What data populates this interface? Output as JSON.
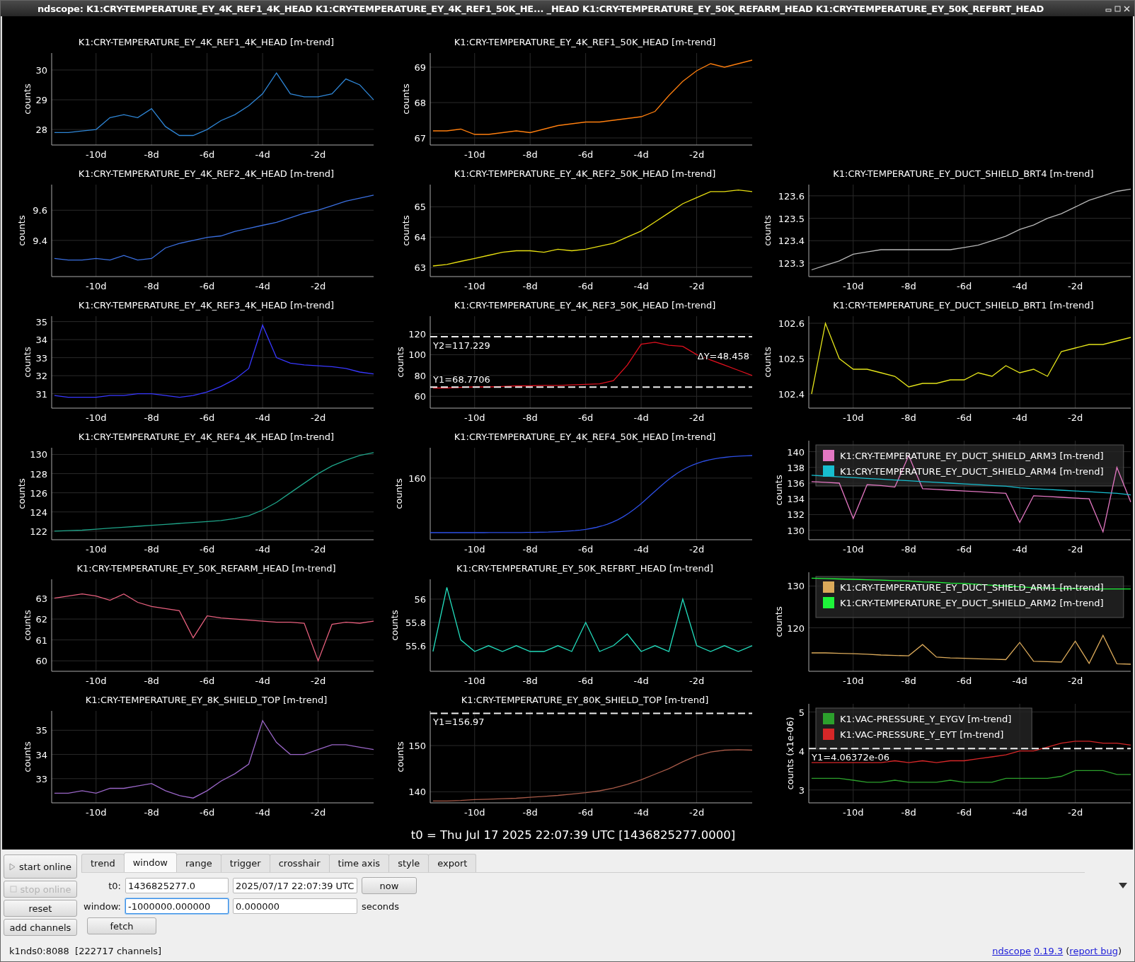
{
  "window": {
    "title": "ndscope: K1:CRY-TEMPERATURE_EY_4K_REF1_4K_HEAD K1:CRY-TEMPERATURE_EY_4K_REF1_50K_HE...  _HEAD K1:CRY-TEMPERATURE_EY_50K_REFARM_HEAD K1:CRY-TEMPERATURE_EY_50K_REFBRT_HEAD"
  },
  "plots": [
    {
      "kind": "chart",
      "chart_data": {
        "type": "line",
        "title": "K1:CRY-TEMPERATURE_EY_4K_REF1_4K_HEAD [m-trend]",
        "ylabel": "counts",
        "grid": true,
        "x": [
          -11.5,
          -11,
          -10.5,
          -10,
          -9.5,
          -9,
          -8.5,
          -8,
          -7.5,
          -7,
          -6.5,
          -6,
          -5.5,
          -5,
          -4.5,
          -4,
          -3.5,
          -3,
          -2.5,
          -2,
          -1.5,
          -1,
          -0.5,
          0
        ],
        "xlim": [
          -11.6,
          0
        ],
        "ylim": [
          27.48,
          30.57
        ],
        "xticks": [
          {
            "value": -10,
            "label": "-10d"
          },
          {
            "value": -8,
            "label": "-8d"
          },
          {
            "value": -6,
            "label": "-6d"
          },
          {
            "value": -4,
            "label": "-4d"
          },
          {
            "value": -2,
            "label": "-2d"
          }
        ],
        "yticks": [
          28,
          29,
          30
        ],
        "series": [
          {
            "color": "#2f86d6",
            "values": [
              27.9,
              27.9,
              27.95,
              28.0,
              28.4,
              28.5,
              28.4,
              28.7,
              28.1,
              27.8,
              27.8,
              28.0,
              28.3,
              28.5,
              28.8,
              29.2,
              29.9,
              29.2,
              29.1,
              29.1,
              29.2,
              29.7,
              29.5,
              29.0
            ]
          }
        ]
      }
    },
    {
      "kind": "chart",
      "chart_data": {
        "type": "line",
        "title": "K1:CRY-TEMPERATURE_EY_4K_REF1_50K_HEAD [m-trend]",
        "ylabel": "counts",
        "grid": true,
        "x": [
          -11.5,
          -11,
          -10.5,
          -10,
          -9.5,
          -9,
          -8.5,
          -8,
          -7.5,
          -7,
          -6.5,
          -6,
          -5.5,
          -5,
          -4.5,
          -4,
          -3.5,
          -3,
          -2.5,
          -2,
          -1.5,
          -1,
          -0.5,
          0
        ],
        "xlim": [
          -11.6,
          0
        ],
        "ylim": [
          66.8,
          69.4
        ],
        "xticks": [
          {
            "value": -10,
            "label": "-10d"
          },
          {
            "value": -8,
            "label": "-8d"
          },
          {
            "value": -6,
            "label": "-6d"
          },
          {
            "value": -4,
            "label": "-4d"
          },
          {
            "value": -2,
            "label": "-2d"
          }
        ],
        "yticks": [
          67,
          68,
          69
        ],
        "series": [
          {
            "color": "#ff7f0e",
            "values": [
              67.2,
              67.2,
              67.25,
              67.1,
              67.1,
              67.15,
              67.2,
              67.15,
              67.25,
              67.35,
              67.4,
              67.45,
              67.45,
              67.5,
              67.55,
              67.6,
              67.75,
              68.2,
              68.6,
              68.9,
              69.1,
              69.0,
              69.1,
              69.2
            ]
          }
        ]
      }
    },
    {
      "kind": "empty"
    },
    {
      "kind": "chart",
      "chart_data": {
        "type": "line",
        "title": "K1:CRY-TEMPERATURE_EY_4K_REF2_4K_HEAD [m-trend]",
        "ylabel": "counts",
        "grid": true,
        "x": [
          -11.5,
          -11,
          -10.5,
          -10,
          -9.5,
          -9,
          -8.5,
          -8,
          -7.5,
          -7,
          -6.5,
          -6,
          -5.5,
          -5,
          -4.5,
          -4,
          -3.5,
          -3,
          -2.5,
          -2,
          -1.5,
          -1,
          -0.5,
          0
        ],
        "xlim": [
          -11.6,
          0
        ],
        "ylim": [
          9.16,
          9.77
        ],
        "xticks": [
          {
            "value": -10,
            "label": "-10d"
          },
          {
            "value": -8,
            "label": "-8d"
          },
          {
            "value": -6,
            "label": "-6d"
          },
          {
            "value": -4,
            "label": "-4d"
          },
          {
            "value": -2,
            "label": "-2d"
          }
        ],
        "yticks": [
          9.4,
          9.6
        ],
        "series": [
          {
            "color": "#3a6fe0",
            "values": [
              9.28,
              9.27,
              9.27,
              9.28,
              9.27,
              9.3,
              9.27,
              9.28,
              9.35,
              9.38,
              9.4,
              9.42,
              9.43,
              9.46,
              9.48,
              9.5,
              9.52,
              9.55,
              9.58,
              9.6,
              9.63,
              9.66,
              9.68,
              9.7
            ]
          }
        ]
      }
    },
    {
      "kind": "chart",
      "chart_data": {
        "type": "line",
        "title": "K1:CRY-TEMPERATURE_EY_4K_REF2_50K_HEAD [m-trend]",
        "ylabel": "counts",
        "grid": true,
        "x": [
          -11.5,
          -11,
          -10.5,
          -10,
          -9.5,
          -9,
          -8.5,
          -8,
          -7.5,
          -7,
          -6.5,
          -6,
          -5.5,
          -5,
          -4.5,
          -4,
          -3.5,
          -3,
          -2.5,
          -2,
          -1.5,
          -1,
          -0.5,
          0
        ],
        "xlim": [
          -11.6,
          0
        ],
        "ylim": [
          62.7,
          65.73
        ],
        "xticks": [
          {
            "value": -10,
            "label": "-10d"
          },
          {
            "value": -8,
            "label": "-8d"
          },
          {
            "value": -6,
            "label": "-6d"
          },
          {
            "value": -4,
            "label": "-4d"
          },
          {
            "value": -2,
            "label": "-2d"
          }
        ],
        "yticks": [
          63,
          64,
          65
        ],
        "series": [
          {
            "color": "#e8e010",
            "values": [
              63.05,
              63.1,
              63.2,
              63.3,
              63.4,
              63.5,
              63.55,
              63.55,
              63.5,
              63.6,
              63.55,
              63.6,
              63.7,
              63.8,
              64.0,
              64.2,
              64.5,
              64.8,
              65.1,
              65.3,
              65.5,
              65.5,
              65.55,
              65.5
            ]
          }
        ]
      }
    },
    {
      "kind": "chart",
      "chart_data": {
        "type": "line",
        "title": "K1:CRY-TEMPERATURE_EY_DUCT_SHIELD_BRT4 [m-trend]",
        "ylabel": "counts",
        "grid": true,
        "x": [
          -11.5,
          -11,
          -10.5,
          -10,
          -9.5,
          -9,
          -8.5,
          -8,
          -7.5,
          -7,
          -6.5,
          -6,
          -5.5,
          -5,
          -4.5,
          -4,
          -3.5,
          -3,
          -2.5,
          -2,
          -1.5,
          -1,
          -0.5,
          0
        ],
        "xlim": [
          -11.6,
          0
        ],
        "ylim": [
          123.24,
          123.65
        ],
        "xticks": [
          {
            "value": -10,
            "label": "-10d"
          },
          {
            "value": -8,
            "label": "-8d"
          },
          {
            "value": -6,
            "label": "-6d"
          },
          {
            "value": -4,
            "label": "-4d"
          },
          {
            "value": -2,
            "label": "-2d"
          }
        ],
        "yticks": [
          123.3,
          123.4,
          123.5,
          123.6
        ],
        "series": [
          {
            "color": "#b8b8b8",
            "values": [
              123.27,
              123.29,
              123.31,
              123.34,
              123.35,
              123.36,
              123.36,
              123.36,
              123.36,
              123.36,
              123.36,
              123.37,
              123.38,
              123.4,
              123.42,
              123.45,
              123.47,
              123.5,
              123.52,
              123.55,
              123.58,
              123.6,
              123.62,
              123.63
            ]
          }
        ]
      }
    },
    {
      "kind": "chart",
      "chart_data": {
        "type": "line",
        "title": "K1:CRY-TEMPERATURE_EY_4K_REF3_4K_HEAD [m-trend]",
        "ylabel": "counts",
        "grid": true,
        "x": [
          -11.5,
          -11,
          -10.5,
          -10,
          -9.5,
          -9,
          -8.5,
          -8,
          -7.5,
          -7,
          -6.5,
          -6,
          -5.5,
          -5,
          -4.5,
          -4,
          -3.5,
          -3,
          -2.5,
          -2,
          -1.5,
          -1,
          -0.5,
          0
        ],
        "xlim": [
          -11.6,
          0
        ],
        "ylim": [
          30.2,
          35.3
        ],
        "xticks": [
          {
            "value": -10,
            "label": "-10d"
          },
          {
            "value": -8,
            "label": "-8d"
          },
          {
            "value": -6,
            "label": "-6d"
          },
          {
            "value": -4,
            "label": "-4d"
          },
          {
            "value": -2,
            "label": "-2d"
          }
        ],
        "yticks": [
          31,
          32,
          33,
          34,
          35
        ],
        "series": [
          {
            "color": "#3838ff",
            "values": [
              30.9,
              30.8,
              30.8,
              30.8,
              30.9,
              30.9,
              31.0,
              31.0,
              30.9,
              30.8,
              30.9,
              31.1,
              31.4,
              31.8,
              32.4,
              34.8,
              33.0,
              32.7,
              32.6,
              32.55,
              32.5,
              32.4,
              32.2,
              32.1
            ]
          }
        ]
      }
    },
    {
      "kind": "chart",
      "chart_data": {
        "type": "line",
        "title": "K1:CRY-TEMPERATURE_EY_4K_REF3_50K_HEAD [m-trend]",
        "ylabel": "counts",
        "grid": true,
        "x": [
          -11.5,
          -11,
          -10.5,
          -10,
          -9.5,
          -9,
          -8.5,
          -8,
          -7.5,
          -7,
          -6.5,
          -6,
          -5.5,
          -5,
          -4.5,
          -4,
          -3.5,
          -3,
          -2.5,
          -2,
          -1.5,
          -1,
          -0.5,
          0
        ],
        "xlim": [
          -11.6,
          0
        ],
        "ylim": [
          48.6,
          137
        ],
        "xticks": [
          {
            "value": -10,
            "label": "-10d"
          },
          {
            "value": -8,
            "label": "-8d"
          },
          {
            "value": -6,
            "label": "-6d"
          },
          {
            "value": -4,
            "label": "-4d"
          },
          {
            "value": -2,
            "label": "-2d"
          }
        ],
        "yticks": [
          60,
          80,
          100,
          120
        ],
        "series": [
          {
            "color": "#e0101e",
            "values": [
              68,
              68,
              68.5,
              69,
              69,
              69.5,
              70,
              70,
              70.5,
              70.5,
              71,
              71.5,
              72,
              75,
              90,
              110,
              112,
              109,
              108,
              100,
              95,
              90,
              85,
              80
            ]
          }
        ],
        "ref_lines": [
          {
            "axis": "y",
            "value": 117.229,
            "label": "Y2=117.229"
          },
          {
            "axis": "y",
            "value": 68.7706,
            "label": "Y1=68.7706"
          }
        ],
        "annotations": [
          {
            "text": "ΔY=48.458"
          }
        ]
      }
    },
    {
      "kind": "chart",
      "chart_data": {
        "type": "line",
        "title": "K1:CRY-TEMPERATURE_EY_DUCT_SHIELD_BRT1 [m-trend]",
        "ylabel": "counts",
        "grid": true,
        "x": [
          -11.5,
          -11,
          -10.5,
          -10,
          -9.5,
          -9,
          -8.5,
          -8,
          -7.5,
          -7,
          -6.5,
          -6,
          -5.5,
          -5,
          -4.5,
          -4,
          -3.5,
          -3,
          -2.5,
          -2,
          -1.5,
          -1,
          -0.5,
          0
        ],
        "xlim": [
          -11.6,
          0
        ],
        "ylim": [
          102.36,
          102.62
        ],
        "xticks": [
          {
            "value": -10,
            "label": "-10d"
          },
          {
            "value": -8,
            "label": "-8d"
          },
          {
            "value": -6,
            "label": "-6d"
          },
          {
            "value": -4,
            "label": "-4d"
          },
          {
            "value": -2,
            "label": "-2d"
          }
        ],
        "yticks": [
          102.4,
          102.5,
          102.6
        ],
        "series": [
          {
            "color": "#e4e41a",
            "values": [
              102.4,
              102.6,
              102.5,
              102.47,
              102.47,
              102.46,
              102.45,
              102.42,
              102.43,
              102.43,
              102.44,
              102.44,
              102.46,
              102.45,
              102.48,
              102.46,
              102.47,
              102.45,
              102.52,
              102.53,
              102.54,
              102.54,
              102.55,
              102.56
            ]
          }
        ]
      }
    },
    {
      "kind": "chart",
      "chart_data": {
        "type": "line",
        "title": "K1:CRY-TEMPERATURE_EY_4K_REF4_4K_HEAD [m-trend]",
        "ylabel": "counts",
        "grid": true,
        "x": [
          -11.5,
          -11,
          -10.5,
          -10,
          -9.5,
          -9,
          -8.5,
          -8,
          -7.5,
          -7,
          -6.5,
          -6,
          -5.5,
          -5,
          -4.5,
          -4,
          -3.5,
          -3,
          -2.5,
          -2,
          -1.5,
          -1,
          -0.5,
          0
        ],
        "xlim": [
          -11.6,
          0
        ],
        "ylim": [
          121.1,
          130.7
        ],
        "xticks": [
          {
            "value": -10,
            "label": "-10d"
          },
          {
            "value": -8,
            "label": "-8d"
          },
          {
            "value": -6,
            "label": "-6d"
          },
          {
            "value": -4,
            "label": "-4d"
          },
          {
            "value": -2,
            "label": "-2d"
          }
        ],
        "yticks": [
          122,
          124,
          126,
          128,
          130
        ],
        "series": [
          {
            "color": "#1fa58a",
            "values": [
              122,
              122.05,
              122.1,
              122.2,
              122.3,
              122.4,
              122.5,
              122.6,
              122.7,
              122.8,
              122.9,
              123,
              123.1,
              123.3,
              123.6,
              124.2,
              125,
              126,
              127,
              128,
              128.8,
              129.4,
              129.9,
              130.2
            ]
          }
        ]
      }
    },
    {
      "kind": "trace",
      "title": "K1:CRY-TEMPERATURE_EY_4K_REF4_50K_HEAD [m-trend]",
      "ylabel": "counts",
      "ytick": "160",
      "xticks": [
        "-10d",
        "-8d",
        "-6d",
        "-4d",
        "-2d"
      ],
      "color": "#2d4fe6"
    },
    {
      "kind": "chart",
      "chart_data": {
        "type": "line",
        "ylabel": "counts",
        "grid": true,
        "x": [
          -11.5,
          -11,
          -10.5,
          -10,
          -9.5,
          -9,
          -8.5,
          -8,
          -7.5,
          -7,
          -6.5,
          -6,
          -5.5,
          -5,
          -4.5,
          -4,
          -3.5,
          -3,
          -2.5,
          -2,
          -1.5,
          -1,
          -0.5,
          0
        ],
        "xlim": [
          -11.6,
          0
        ],
        "ylim": [
          128.8,
          141.4
        ],
        "xticks": [
          {
            "value": -10,
            "label": "-10d"
          },
          {
            "value": -8,
            "label": "-8d"
          },
          {
            "value": -6,
            "label": "-6d"
          },
          {
            "value": -4,
            "label": "-4d"
          },
          {
            "value": -2,
            "label": "-2d"
          }
        ],
        "yticks": [
          130,
          132,
          134,
          136,
          138,
          140
        ],
        "series": [
          {
            "name": "K1:CRY-TEMPERATURE_EY_DUCT_SHIELD_ARM3 [m-trend]",
            "color": "#e377c2",
            "values": [
              136.2,
              136.1,
              136.0,
              131.5,
              135.8,
              135.7,
              135.5,
              139.5,
              135.3,
              135.2,
              135.1,
              135.0,
              134.9,
              134.8,
              134.7,
              131.0,
              134.4,
              134.3,
              134.2,
              134.1,
              134.0,
              129.8,
              138.0,
              133.6
            ]
          },
          {
            "name": "K1:CRY-TEMPERATURE_EY_DUCT_SHIELD_ARM4 [m-trend]",
            "color": "#17becf",
            "values": [
              137.0,
              136.9,
              136.8,
              136.7,
              136.6,
              136.5,
              136.4,
              136.3,
              136.2,
              136.1,
              136.0,
              135.9,
              135.8,
              135.7,
              135.6,
              135.4,
              135.3,
              135.2,
              135.1,
              135.0,
              134.9,
              134.8,
              134.7,
              134.5
            ]
          }
        ]
      }
    },
    {
      "kind": "chart",
      "chart_data": {
        "type": "line",
        "title": "K1:CRY-TEMPERATURE_EY_50K_REFARM_HEAD [m-trend]",
        "ylabel": "counts",
        "grid": true,
        "x": [
          -11.5,
          -11,
          -10.5,
          -10,
          -9.5,
          -9,
          -8.5,
          -8,
          -7.5,
          -7,
          -6.5,
          -6,
          -5.5,
          -5,
          -4.5,
          -4,
          -3.5,
          -3,
          -2.5,
          -2,
          -1.5,
          -1,
          -0.5,
          0
        ],
        "xlim": [
          -11.6,
          0
        ],
        "ylim": [
          59.5,
          63.9
        ],
        "xticks": [
          {
            "value": -10,
            "label": "-10d"
          },
          {
            "value": -8,
            "label": "-8d"
          },
          {
            "value": -6,
            "label": "-6d"
          },
          {
            "value": -4,
            "label": "-4d"
          },
          {
            "value": -2,
            "label": "-2d"
          }
        ],
        "yticks": [
          60,
          61,
          62,
          63
        ],
        "series": [
          {
            "color": "#e8607e",
            "values": [
              63.0,
              63.1,
              63.2,
              63.1,
              62.9,
              63.2,
              62.8,
              62.6,
              62.5,
              62.4,
              61.1,
              62.15,
              62.05,
              62.0,
              61.95,
              61.9,
              61.85,
              61.85,
              61.8,
              60.0,
              61.75,
              61.85,
              61.8,
              61.9
            ]
          }
        ]
      }
    },
    {
      "kind": "chart",
      "chart_data": {
        "type": "line",
        "title": "K1:CRY-TEMPERATURE_EY_50K_REFBRT_HEAD [m-trend]",
        "ylabel": "counts",
        "grid": true,
        "x": [
          -11.5,
          -11,
          -10.5,
          -10,
          -9.5,
          -9,
          -8.5,
          -8,
          -7.5,
          -7,
          -6.5,
          -6,
          -5.5,
          -5,
          -4.5,
          -4,
          -3.5,
          -3,
          -2.5,
          -2,
          -1.5,
          -1,
          -0.5,
          0
        ],
        "xlim": [
          -11.6,
          0
        ],
        "ylim": [
          55.38,
          56.17
        ],
        "xticks": [
          {
            "value": -10,
            "label": "-10d"
          },
          {
            "value": -8,
            "label": "-8d"
          },
          {
            "value": -6,
            "label": "-6d"
          },
          {
            "value": -4,
            "label": "-4d"
          },
          {
            "value": -2,
            "label": "-2d"
          }
        ],
        "yticks": [
          55.6,
          55.8,
          56
        ],
        "series": [
          {
            "color": "#22dcbc",
            "values": [
              55.55,
              56.1,
              55.65,
              55.55,
              55.6,
              55.55,
              55.6,
              55.55,
              55.55,
              55.6,
              55.55,
              55.8,
              55.55,
              55.6,
              55.7,
              55.55,
              55.6,
              55.55,
              56.0,
              55.6,
              55.55,
              55.6,
              55.55,
              55.6
            ]
          }
        ]
      }
    },
    {
      "kind": "chart",
      "chart_data": {
        "type": "line",
        "ylabel": "counts",
        "grid": true,
        "x": [
          -11.5,
          -11,
          -10.5,
          -10,
          -9.5,
          -9,
          -8.5,
          -8,
          -7.5,
          -7,
          -6.5,
          -6,
          -5.5,
          -5,
          -4.5,
          -4,
          -3.5,
          -3,
          -2.5,
          -2,
          -1.5,
          -1,
          -0.5,
          0
        ],
        "xlim": [
          -11.6,
          0
        ],
        "ylim": [
          109.6,
          133.3
        ],
        "xticks": [
          {
            "value": -10,
            "label": "-10d"
          },
          {
            "value": -8,
            "label": "-8d"
          },
          {
            "value": -6,
            "label": "-6d"
          },
          {
            "value": -4,
            "label": "-4d"
          },
          {
            "value": -2,
            "label": "-2d"
          }
        ],
        "yticks": [
          120,
          130
        ],
        "series": [
          {
            "name": "K1:CRY-TEMPERATURE_EY_DUCT_SHIELD_ARM1 [m-trend]",
            "color": "#dbaa5a",
            "values": [
              114,
              114,
              113.9,
              113.8,
              113.7,
              113.5,
              113.4,
              113.3,
              116,
              113.0,
              112.8,
              112.7,
              112.6,
              112.5,
              112.4,
              116.5,
              112.0,
              111.9,
              111.8,
              116.8,
              111.5,
              118.2,
              111.4,
              111.3
            ]
          },
          {
            "name": "K1:CRY-TEMPERATURE_EY_DUCT_SHIELD_ARM2 [m-trend]",
            "color": "#1ef53a",
            "values": [
              131.9,
              131.8,
              131.7,
              131.6,
              131.5,
              131.4,
              131.3,
              131.2,
              131.0,
              130.9,
              130.7,
              130.6,
              130.4,
              130.2,
              130.0,
              129.8,
              129.6,
              129.5,
              129.4,
              129.4,
              129.3,
              129.3,
              129.3,
              129.3
            ]
          }
        ]
      }
    },
    {
      "kind": "chart",
      "chart_data": {
        "type": "line",
        "title": "K1:CRY-TEMPERATURE_EY_8K_SHIELD_TOP [m-trend]",
        "ylabel": "counts",
        "grid": true,
        "x": [
          -11.5,
          -11,
          -10.5,
          -10,
          -9.5,
          -9,
          -8.5,
          -8,
          -7.5,
          -7,
          -6.5,
          -6,
          -5.5,
          -5,
          -4.5,
          -4,
          -3.5,
          -3,
          -2.5,
          -2,
          -1.5,
          -1,
          -0.5,
          0
        ],
        "xlim": [
          -11.6,
          0
        ],
        "ylim": [
          32.0,
          35.8
        ],
        "xticks": [
          {
            "value": -10,
            "label": "-10d"
          },
          {
            "value": -8,
            "label": "-8d"
          },
          {
            "value": -6,
            "label": "-6d"
          },
          {
            "value": -4,
            "label": "-4d"
          },
          {
            "value": -2,
            "label": "-2d"
          }
        ],
        "yticks": [
          33,
          34,
          35
        ],
        "series": [
          {
            "color": "#9a66c8",
            "values": [
              32.4,
              32.4,
              32.5,
              32.4,
              32.6,
              32.6,
              32.7,
              32.8,
              32.5,
              32.3,
              32.2,
              32.5,
              32.9,
              33.2,
              33.6,
              35.4,
              34.5,
              34.0,
              34.0,
              34.2,
              34.4,
              34.4,
              34.3,
              34.2
            ]
          }
        ]
      }
    },
    {
      "kind": "chart",
      "chart_data": {
        "type": "line",
        "title": "K1:CRY-TEMPERATURE_EY_80K_SHIELD_TOP [m-trend]",
        "ylabel": "counts",
        "grid": true,
        "x": [
          -11.5,
          -11,
          -10.5,
          -10,
          -9.5,
          -9,
          -8.5,
          -8,
          -7.5,
          -7,
          -6.5,
          -6,
          -5.5,
          -5,
          -4.5,
          -4,
          -3.5,
          -3,
          -2.5,
          -2,
          -1.5,
          -1,
          -0.5,
          0
        ],
        "xlim": [
          -11.6,
          0
        ],
        "ylim": [
          137.6,
          157.5
        ],
        "xticks": [
          {
            "value": -10,
            "label": "-10d"
          },
          {
            "value": -8,
            "label": "-8d"
          },
          {
            "value": -6,
            "label": "-6d"
          },
          {
            "value": -4,
            "label": "-4d"
          },
          {
            "value": -2,
            "label": "-2d"
          }
        ],
        "yticks": [
          140,
          150
        ],
        "series": [
          {
            "color": "#a85a48",
            "values": [
              138,
              138,
              138.1,
              138.3,
              138.4,
              138.5,
              138.6,
              138.8,
              139,
              139.2,
              139.5,
              139.8,
              140.2,
              140.8,
              141.6,
              142.6,
              143.8,
              145,
              146.5,
              147.8,
              148.6,
              149,
              149.1,
              149.0
            ]
          }
        ],
        "ref_lines": [
          {
            "axis": "y",
            "value": 156.97,
            "label": "Y1=156.97"
          }
        ]
      }
    },
    {
      "kind": "chart",
      "chart_data": {
        "type": "line",
        "ylabel": "counts (x1e-06)",
        "grid": true,
        "x": [
          -11.5,
          -11,
          -10.5,
          -10,
          -9.5,
          -9,
          -8.5,
          -8,
          -7.5,
          -7,
          -6.5,
          -6,
          -5.5,
          -5,
          -4.5,
          -4,
          -3.5,
          -3,
          -2.5,
          -2,
          -1.5,
          -1,
          -0.5,
          0
        ],
        "xlim": [
          -11.6,
          0
        ],
        "ylim": [
          2.67,
          5.21
        ],
        "xticks": [
          {
            "value": -10,
            "label": "-10d"
          },
          {
            "value": -8,
            "label": "-8d"
          },
          {
            "value": -6,
            "label": "-6d"
          },
          {
            "value": -4,
            "label": "-4d"
          },
          {
            "value": -2,
            "label": "-2d"
          }
        ],
        "yticks": [
          3,
          4,
          5
        ],
        "series": [
          {
            "name": "K1:VAC-PRESSURE_Y_EYGV [m-trend]",
            "color": "#2ca02c",
            "values": [
              3.3,
              3.3,
              3.3,
              3.25,
              3.2,
              3.2,
              3.25,
              3.2,
              3.2,
              3.2,
              3.25,
              3.2,
              3.2,
              3.2,
              3.3,
              3.3,
              3.3,
              3.3,
              3.35,
              3.5,
              3.5,
              3.5,
              3.4,
              3.4
            ]
          },
          {
            "name": "K1:VAC-PRESSURE_Y_EYT [m-trend]",
            "color": "#d62728",
            "values": [
              3.7,
              3.7,
              3.7,
              3.7,
              3.7,
              3.7,
              3.75,
              3.7,
              3.75,
              3.7,
              3.75,
              3.75,
              3.8,
              3.85,
              3.9,
              4.0,
              4.0,
              4.1,
              4.2,
              4.25,
              4.25,
              4.2,
              4.2,
              4.15
            ]
          }
        ],
        "ref_lines": [
          {
            "axis": "y",
            "value": 4.06372,
            "label": "Y1=4.06372e-06"
          }
        ]
      }
    }
  ],
  "t0_line": "t0 = Thu Jul 17 2025 22:07:39 UTC [1436825277.0000]",
  "buttons": [
    {
      "label": "start online",
      "kind": "start",
      "disabled": false
    },
    {
      "label": "stop online",
      "kind": "stop",
      "disabled": true
    },
    {
      "label": "reset",
      "kind": "plain",
      "disabled": false
    },
    {
      "label": "add channels",
      "kind": "plain",
      "disabled": false
    }
  ],
  "tabs": [
    {
      "label": "trend",
      "selected": false
    },
    {
      "label": "window",
      "selected": true
    },
    {
      "label": "range",
      "selected": false
    },
    {
      "label": "trigger",
      "selected": false
    },
    {
      "label": "crosshair",
      "selected": false
    },
    {
      "label": "time axis",
      "selected": false
    },
    {
      "label": "style",
      "selected": false
    },
    {
      "label": "export",
      "selected": false
    }
  ],
  "window_tab": {
    "t0_label": "t0:",
    "t0_gps": {
      "value": "1436825277.0",
      "focused": false
    },
    "t0_utc": {
      "value": "2025/07/17 22:07:39 UTC",
      "focused": false
    },
    "now_button": "now",
    "window_label": "window:",
    "window_start": {
      "value": "-1000000.000000",
      "focused": true
    },
    "window_end": {
      "value": "0.000000",
      "focused": false
    },
    "units": "seconds",
    "fetch_button": "fetch"
  },
  "status_bar": {
    "server": "k1nds0:8088",
    "channels": "[222717 channels]",
    "about": [
      {
        "text": "ndscope",
        "link": true,
        "gap_before": false
      },
      {
        "text": "0.19.3",
        "link": true,
        "gap_before": true
      },
      {
        "text": "(",
        "link": false,
        "gap_before": true
      },
      {
        "text": "report bug",
        "link": true,
        "gap_before": false
      },
      {
        "text": ")",
        "link": false,
        "gap_before": false
      }
    ]
  }
}
